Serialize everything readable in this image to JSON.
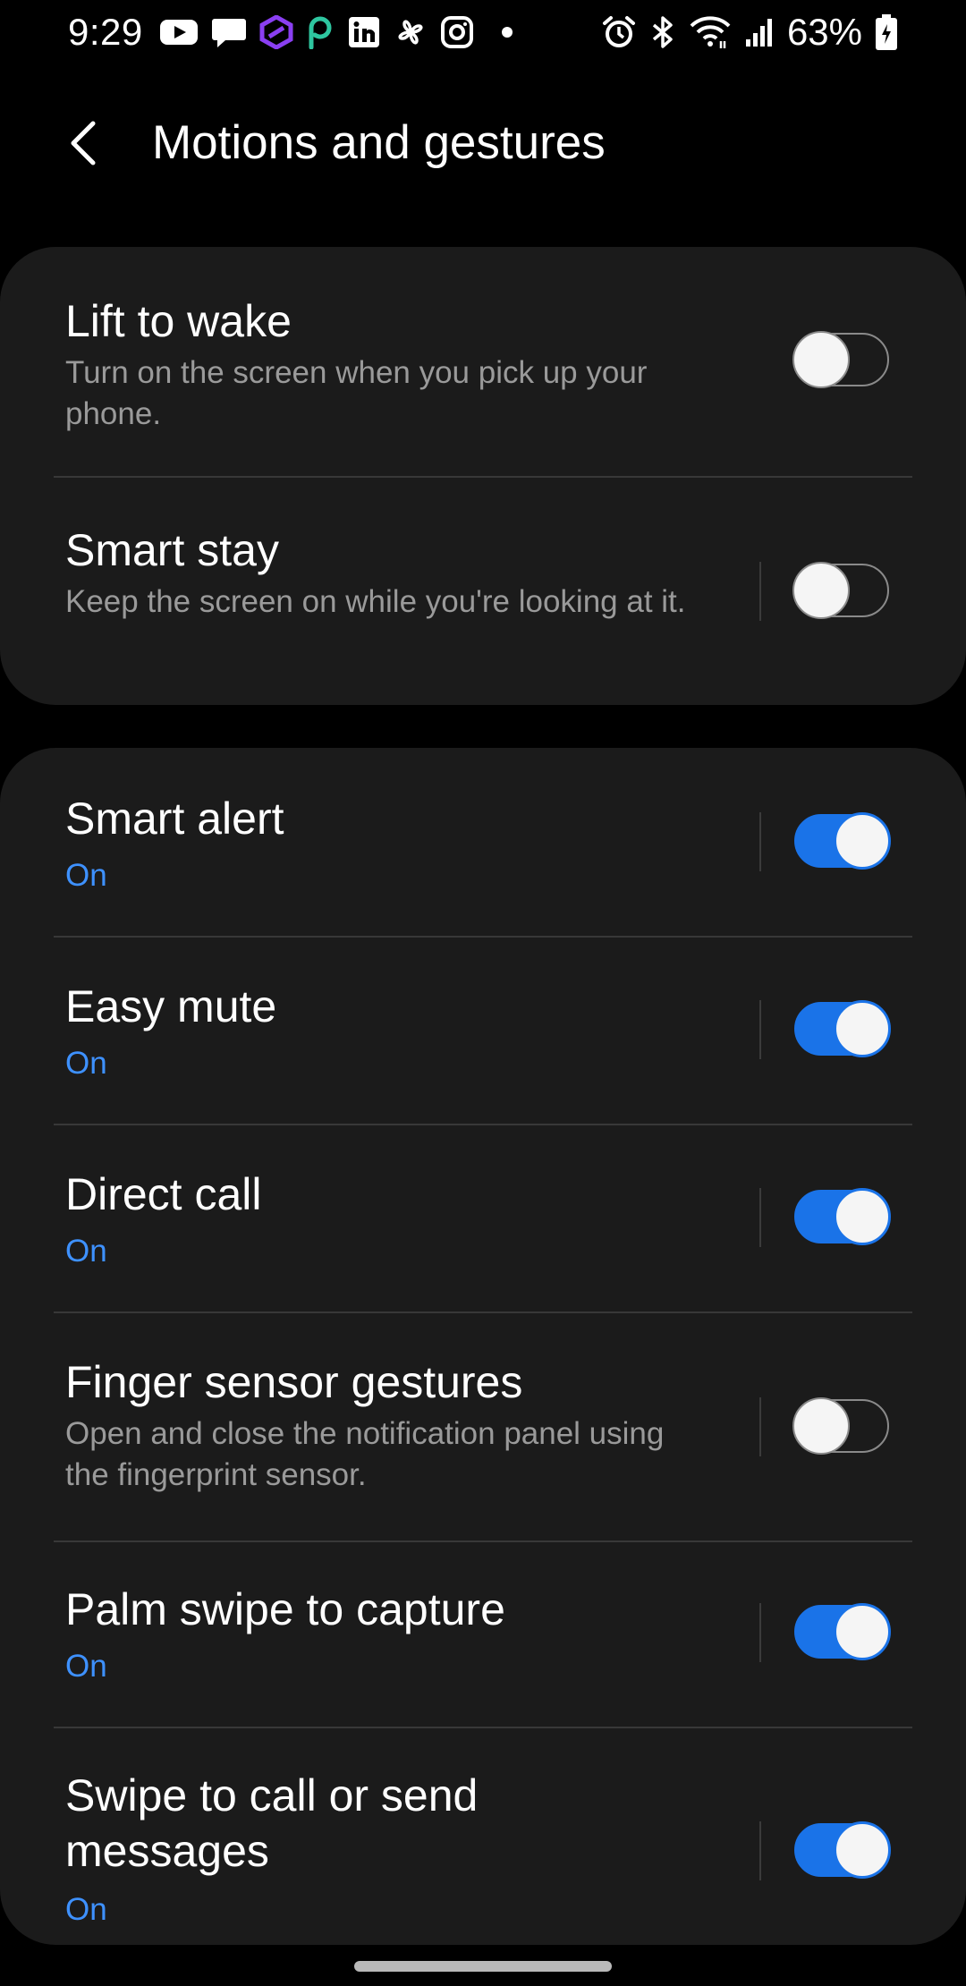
{
  "status_bar": {
    "time": "9:29",
    "battery": "63%",
    "left_icons": [
      "youtube-icon",
      "messages-icon",
      "crypto-icon",
      "p-app-icon",
      "linkedin-icon",
      "pinwheel-icon",
      "instagram-icon",
      "dot-icon"
    ],
    "right_icons": [
      "alarm-icon",
      "bluetooth-icon",
      "wifi-icon",
      "signal-icon",
      "battery-icon"
    ]
  },
  "header": {
    "title": "Motions and gestures"
  },
  "groups": [
    {
      "items": [
        {
          "title": "Lift to wake",
          "subtitle": "Turn on the screen when you pick up your phone.",
          "enabled": false
        },
        {
          "title": "Smart stay",
          "subtitle": "Keep the screen on while you're looking at it.",
          "enabled": false
        }
      ]
    },
    {
      "items": [
        {
          "title": "Smart alert",
          "subtitle": "On",
          "enabled": true
        },
        {
          "title": "Easy mute",
          "subtitle": "On",
          "enabled": true
        },
        {
          "title": "Direct call",
          "subtitle": "On",
          "enabled": true
        },
        {
          "title": "Finger sensor gestures",
          "subtitle": "Open and close the notification panel using the fingerprint sensor.",
          "enabled": false
        },
        {
          "title": "Palm swipe to capture",
          "subtitle": "On",
          "enabled": true
        },
        {
          "title": "Swipe to call or send messages",
          "subtitle": "On",
          "enabled": true
        }
      ]
    }
  ],
  "colors": {
    "background": "#000000",
    "card": "#1b1b1b",
    "accent": "#1a73e8",
    "on_text": "#3e91ff",
    "secondary_text": "#9a9a9a"
  }
}
